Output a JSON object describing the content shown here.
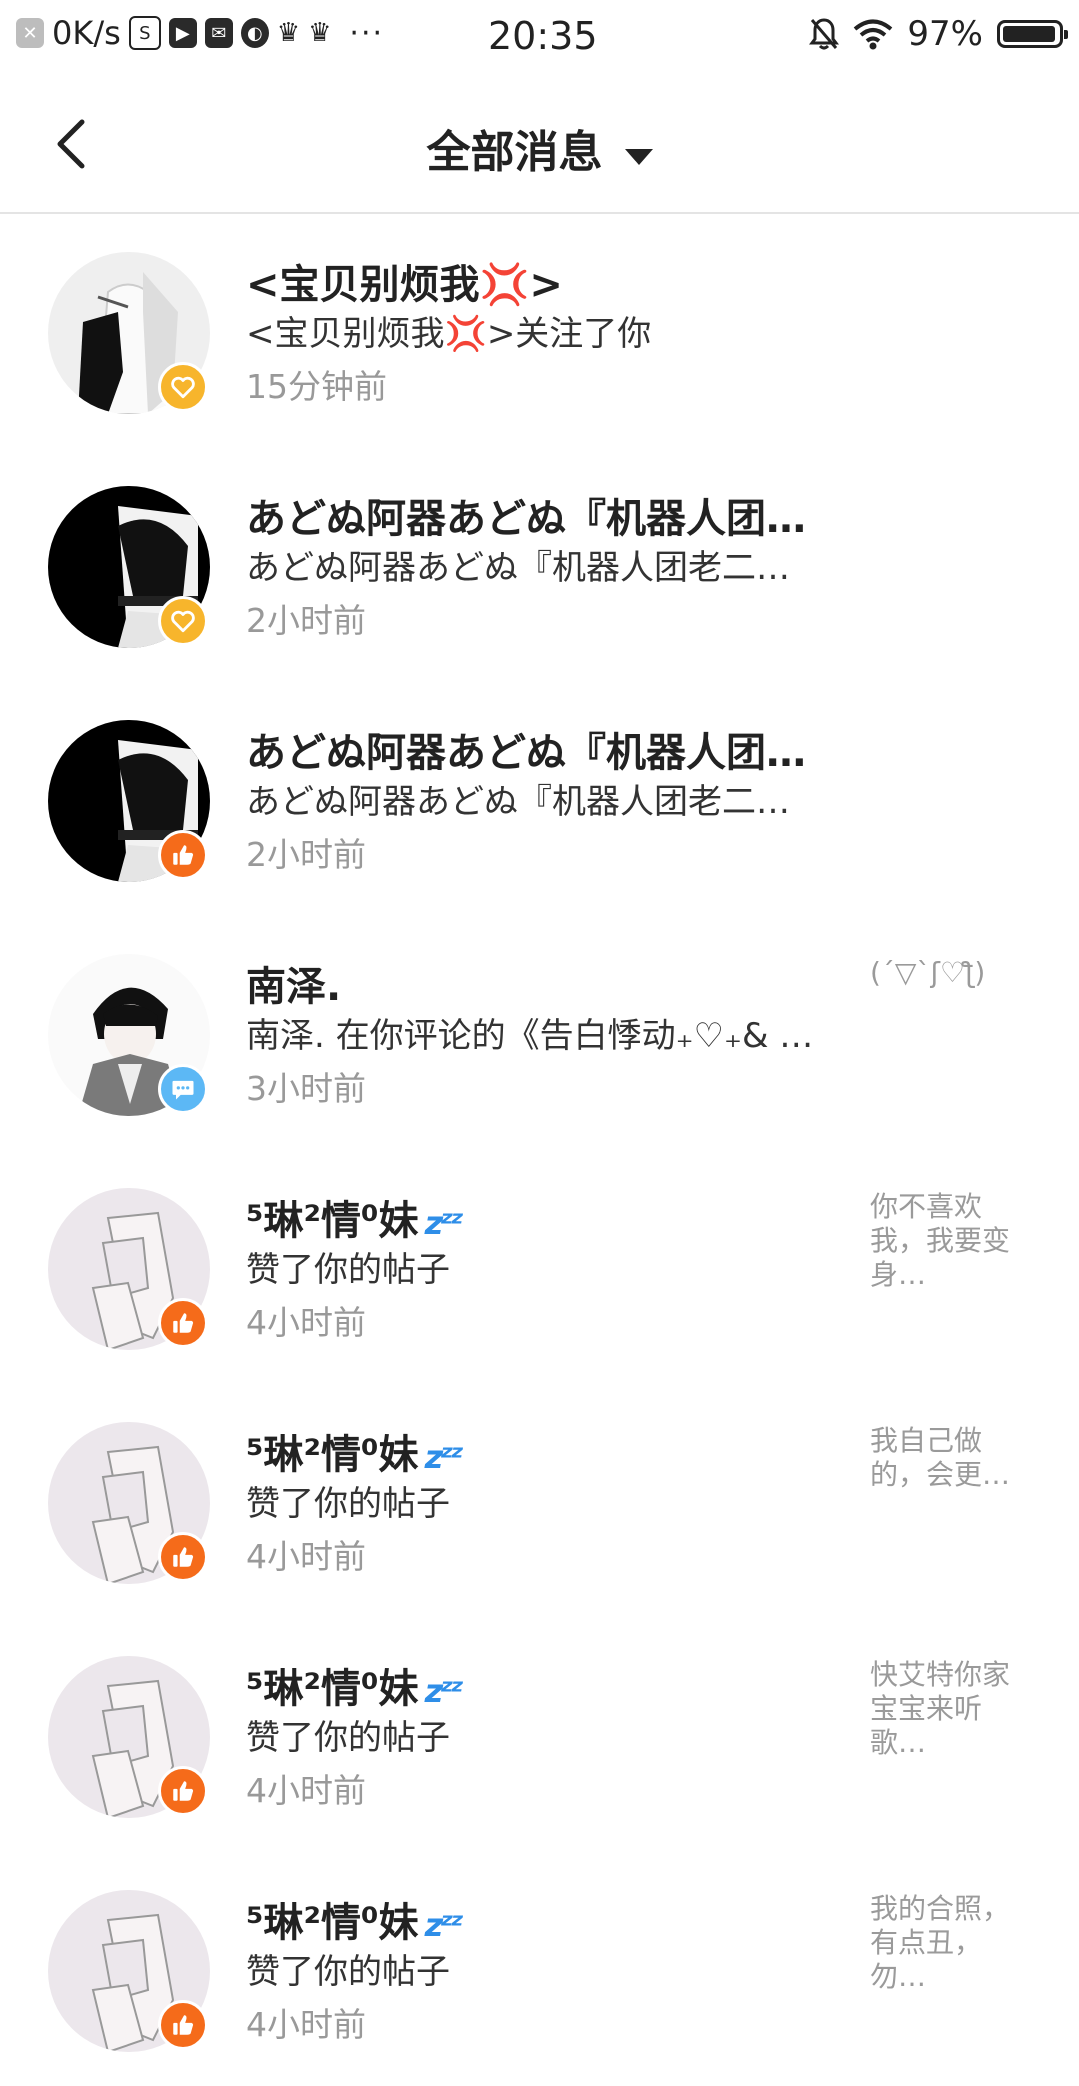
{
  "status_bar": {
    "net_speed": "0K/s",
    "time": "20:35",
    "battery": "97%",
    "battery_level": 0.97,
    "icons": [
      "close-icon",
      "s-icon",
      "play-icon",
      "mail-icon",
      "planet-icon",
      "crown-icon",
      "crown-icon",
      "more-icon",
      "bell-off-icon",
      "wifi-icon",
      "battery-icon"
    ]
  },
  "header": {
    "title": "全部消息"
  },
  "messages": [
    {
      "name": "<宝贝别烦我💢>",
      "desc": "<宝贝别烦我💢>关注了你",
      "time": "15分钟前",
      "badge": "follow",
      "preview": ""
    },
    {
      "name": "あどぬ阿器あどぬ『机器人团…",
      "desc": "あどぬ阿器あどぬ『机器人团老二…",
      "time": "2小时前",
      "badge": "follow",
      "preview": ""
    },
    {
      "name": "あどぬ阿器あどぬ『机器人团…",
      "desc": "あどぬ阿器あどぬ『机器人团老二…",
      "time": "2小时前",
      "badge": "like",
      "preview": ""
    },
    {
      "name": "南泽.",
      "desc": "南泽. 在你评论的《告白悸动₊♡₊& …",
      "time": "3小时前",
      "badge": "comment",
      "preview": "(´▽`ʃ♡ƪ)"
    },
    {
      "name": "⁵琳²情⁰妹",
      "desc": "赞了你的帖子",
      "time": "4小时前",
      "badge": "like",
      "preview": "你不喜欢我，我要变身…"
    },
    {
      "name": "⁵琳²情⁰妹",
      "desc": "赞了你的帖子",
      "time": "4小时前",
      "badge": "like",
      "preview": "我自己做的，会更…"
    },
    {
      "name": "⁵琳²情⁰妹",
      "desc": "赞了你的帖子",
      "time": "4小时前",
      "badge": "like",
      "preview": "快艾特你家宝宝来听歌…"
    },
    {
      "name": "⁵琳²情⁰妹",
      "desc": "赞了你的帖子",
      "time": "4小时前",
      "badge": "like",
      "preview": "我的合照，有点丑，勿…"
    }
  ],
  "colors": {
    "follow_badge": "#f7b52c",
    "like_badge": "#f56b1a",
    "comment_badge": "#5cb8f5",
    "time_text": "#999999",
    "divider": "#e4e4e4"
  }
}
